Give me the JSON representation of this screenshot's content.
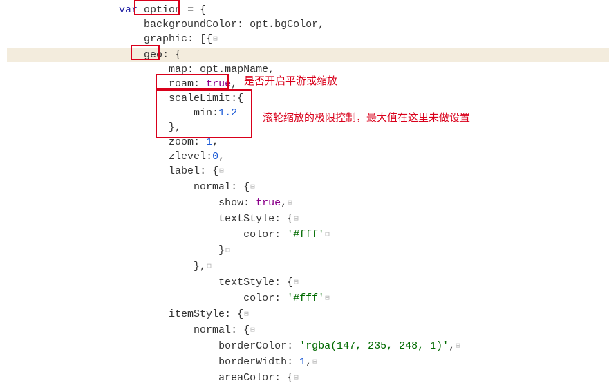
{
  "code": {
    "l1_var": "var ",
    "l1_option": "option",
    "l1_rest": " = {",
    "l2_key": "backgroundColor",
    "l2_val": ": opt.bgColor,",
    "l3_key": "graphic",
    "l3_rest": ": [{",
    "l4_geo": "geo",
    "l4_rest": ": {",
    "l5_key": "map",
    "l5_val": ": opt.mapName,",
    "l6_key": "roam",
    "l6_colon": ": ",
    "l6_true": "true",
    "l6_comma": ",",
    "l7_key": "scaleLimit",
    "l7_rest": ":{",
    "l8_key": "min",
    "l8_colon": ":",
    "l8_val": "1.2",
    "l9": "},",
    "l10_key": "zoom",
    "l10_colon": ": ",
    "l10_val": "1",
    "l10_comma": ",",
    "l11_key": "zlevel",
    "l11_colon": ":",
    "l11_val": "0",
    "l11_comma": ",",
    "l12_key": "label",
    "l12_rest": ": {",
    "l13_key": "normal",
    "l13_rest": ": {",
    "l14_key": "show",
    "l14_colon": ": ",
    "l14_true": "true",
    "l14_comma": ",",
    "l15_key": "textStyle",
    "l15_rest": ": {",
    "l16_key": "color",
    "l16_colon": ": ",
    "l16_str": "'#fff'",
    "l17": "}",
    "l18": "},",
    "l19_key": "textStyle",
    "l19_rest": ": {",
    "l20_key": "color",
    "l20_colon": ": ",
    "l20_str": "'#fff'",
    "l21_key": "itemStyle",
    "l21_rest": ": {",
    "l22_key": "normal",
    "l22_rest": ": {",
    "l23_key": "borderColor",
    "l23_colon": ": ",
    "l23_str": "'rgba(147, 235, 248, 1)'",
    "l23_comma": ",",
    "l24_key": "borderWidth",
    "l24_colon": ": ",
    "l24_val": "1",
    "l24_comma": ",",
    "l25_key": "areaColor",
    "l25_rest": ": {"
  },
  "annotations": {
    "roam_note": "是否开启平游或缩放",
    "scale_note": "滚轮缩放的极限控制，最大值在这里未做设置"
  }
}
